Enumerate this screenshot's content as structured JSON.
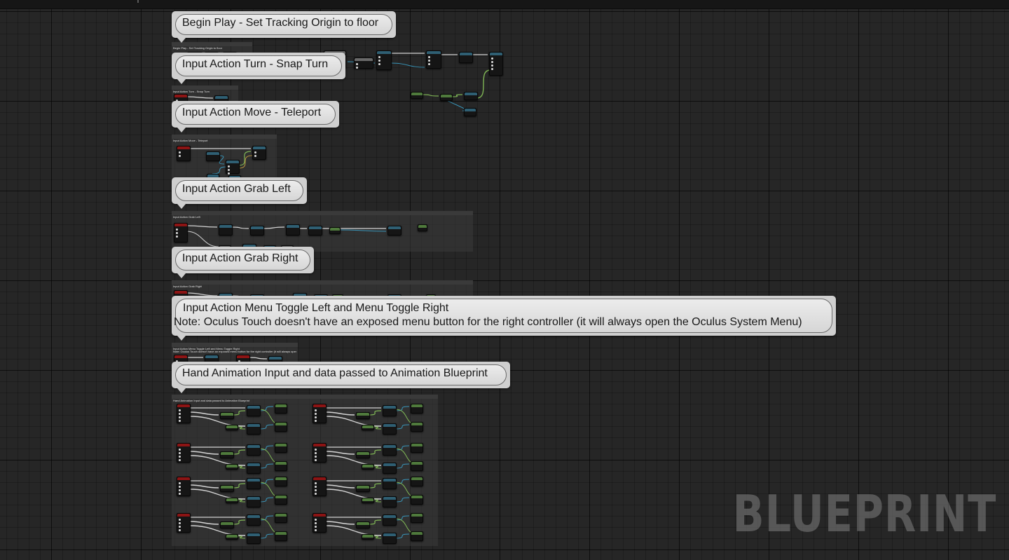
{
  "graph": {
    "comments": [
      {
        "id": "begin-play",
        "label": "Begin Play - Set Tracking Origin to floor",
        "caption": "Begin Play - Set Tracking Origin to floor"
      },
      {
        "id": "turn",
        "label": "Input Action Turn - Snap Turn",
        "caption": "Input Action Turn - Snap Turn"
      },
      {
        "id": "move",
        "label": "Input Action Move - Teleport",
        "caption": "Input Action Move - Teleport"
      },
      {
        "id": "grab-left",
        "label": "Input Action Grab Left",
        "caption": "Input Action Grab Left"
      },
      {
        "id": "grab-right",
        "label": "Input Action Grab Right",
        "caption": "Input Action Grab Right"
      },
      {
        "id": "menu",
        "label": "Input Action Menu Toggle Left and Menu Toggle Right",
        "label_line2": "Note: Oculus Touch doesn't have an exposed menu button for the right controller (it will always open the Oculus System Menu)",
        "caption": "Input Action Menu Toggle Left and Menu Toggle Right",
        "caption_line2": "Note: Oculus Touch doesn't have an exposed menu button for the right controller (it will always open the Oculus System Menu)"
      },
      {
        "id": "hand-anim",
        "label": "Hand Animation Input and data passed to Animation Blueprint",
        "caption": "Hand Animation Input and data passed to Animation Blueprint"
      }
    ],
    "watermark": "BLUEPRINT",
    "colors": {
      "event_node": "#8c1414",
      "function_node": "#2f5f73",
      "pure_node": "#4f7a3c",
      "macro_node": "#6a6a6a",
      "exec_wire": "#e6e6e6",
      "data_wire": "#3aa0c8",
      "bool_wire": "#8a1c1c",
      "float_wire": "#88c45a"
    }
  }
}
